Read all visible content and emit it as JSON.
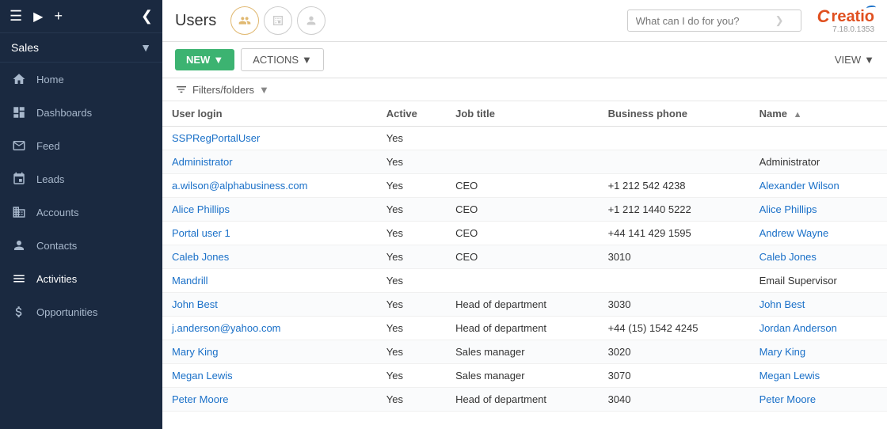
{
  "sidebar": {
    "top_icons": [
      "menu-icon",
      "play-icon",
      "add-icon",
      "back-icon"
    ],
    "sales_label": "Sales",
    "items": [
      {
        "id": "home",
        "label": "Home",
        "icon": "home"
      },
      {
        "id": "dashboards",
        "label": "Dashboards",
        "icon": "bar-chart"
      },
      {
        "id": "feed",
        "label": "Feed",
        "icon": "feed"
      },
      {
        "id": "leads",
        "label": "Leads",
        "icon": "leads"
      },
      {
        "id": "accounts",
        "label": "Accounts",
        "icon": "accounts"
      },
      {
        "id": "contacts",
        "label": "Contacts",
        "icon": "contacts"
      },
      {
        "id": "activities",
        "label": "Activities",
        "icon": "activities"
      },
      {
        "id": "opportunities",
        "label": "Opportunities",
        "icon": "opportunities"
      }
    ]
  },
  "header": {
    "title": "Users",
    "icon_buttons": [
      {
        "id": "users-icon",
        "active": true
      },
      {
        "id": "org-chart-icon",
        "active": false
      },
      {
        "id": "person-icon",
        "active": false
      }
    ],
    "search_placeholder": "What can I do for you?",
    "logo_text": "Creatio",
    "logo_version": "7.18.0.1353"
  },
  "toolbar": {
    "new_label": "NEW",
    "actions_label": "ACTIONS",
    "view_label": "VIEW",
    "new_dropdown": true,
    "actions_dropdown": true,
    "view_dropdown": true
  },
  "filters": {
    "icon": "filter",
    "label": "Filters/folders",
    "dropdown": true
  },
  "table": {
    "columns": [
      {
        "id": "user-login",
        "label": "User login",
        "sortable": false
      },
      {
        "id": "active",
        "label": "Active",
        "sortable": false
      },
      {
        "id": "job-title",
        "label": "Job title",
        "sortable": false
      },
      {
        "id": "business-phone",
        "label": "Business phone",
        "sortable": false
      },
      {
        "id": "name",
        "label": "Name",
        "sortable": true,
        "sort_direction": "asc"
      }
    ],
    "rows": [
      {
        "user_login": "SSPRegPortalUser",
        "active": "Yes",
        "job_title": "",
        "business_phone": "",
        "name": ""
      },
      {
        "user_login": "Administrator",
        "active": "Yes",
        "job_title": "",
        "business_phone": "",
        "name": "Administrator"
      },
      {
        "user_login": "a.wilson@alphabusiness.com",
        "active": "Yes",
        "job_title": "CEO",
        "business_phone": "+1 212 542 4238",
        "name": "Alexander Wilson"
      },
      {
        "user_login": "Alice Phillips",
        "active": "Yes",
        "job_title": "CEO",
        "business_phone": "+1 212 1440 5222",
        "name": "Alice Phillips"
      },
      {
        "user_login": "Portal user 1",
        "active": "Yes",
        "job_title": "CEO",
        "business_phone": "+44 141 429 1595",
        "name": "Andrew Wayne"
      },
      {
        "user_login": "Caleb Jones",
        "active": "Yes",
        "job_title": "CEO",
        "business_phone": "3010",
        "name": "Caleb Jones"
      },
      {
        "user_login": "Mandrill",
        "active": "Yes",
        "job_title": "",
        "business_phone": "",
        "name": "Email Supervisor"
      },
      {
        "user_login": "John Best",
        "active": "Yes",
        "job_title": "Head of department",
        "business_phone": "3030",
        "name": "John Best"
      },
      {
        "user_login": "j.anderson@yahoo.com",
        "active": "Yes",
        "job_title": "Head of department",
        "business_phone": "+44 (15) 1542 4245",
        "name": "Jordan Anderson"
      },
      {
        "user_login": "Mary King",
        "active": "Yes",
        "job_title": "Sales manager",
        "business_phone": "3020",
        "name": "Mary King"
      },
      {
        "user_login": "Megan Lewis",
        "active": "Yes",
        "job_title": "Sales manager",
        "business_phone": "3070",
        "name": "Megan Lewis"
      },
      {
        "user_login": "Peter Moore",
        "active": "Yes",
        "job_title": "Head of department",
        "business_phone": "3040",
        "name": "Peter Moore"
      }
    ]
  }
}
